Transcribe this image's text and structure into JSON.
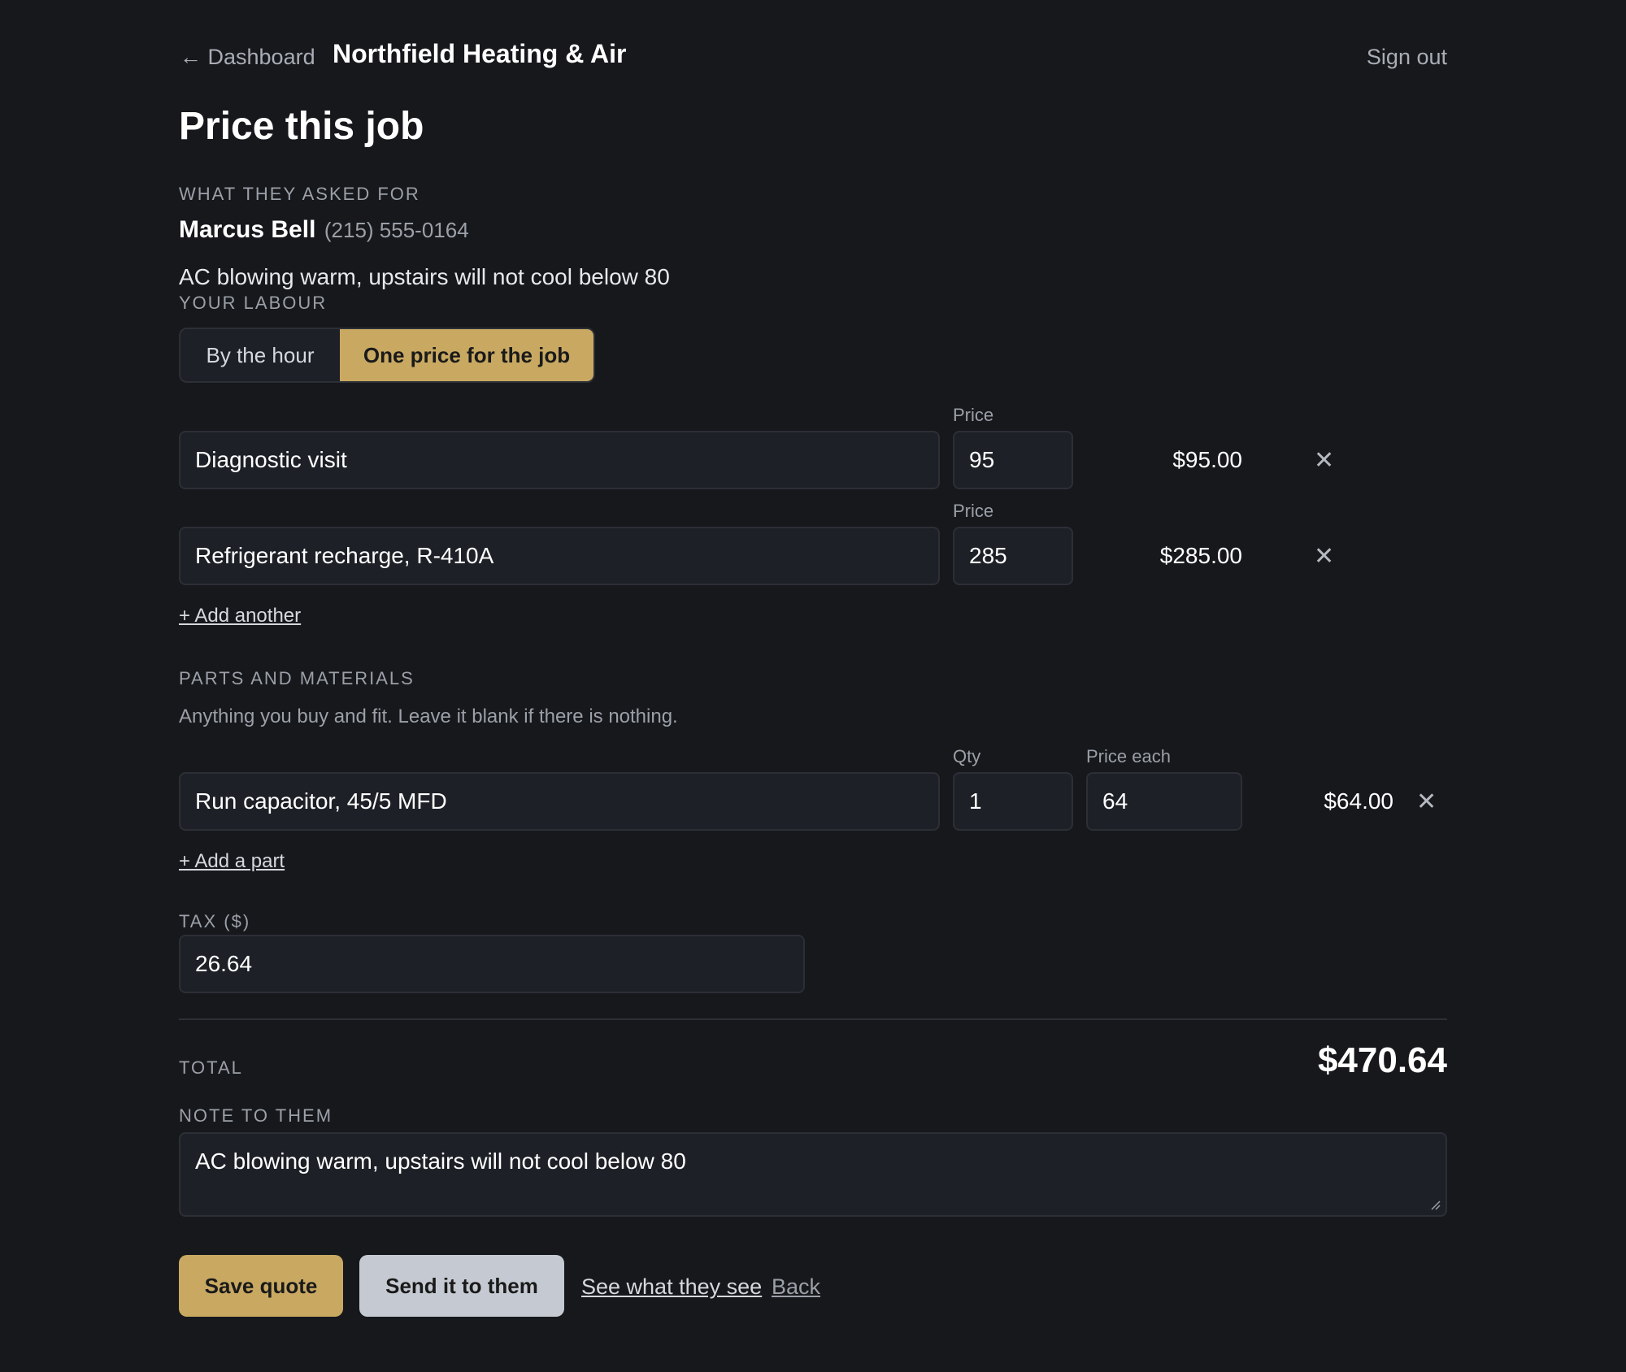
{
  "header": {
    "back_label": "← Dashboard",
    "business_name": "Northfield Heating & Air",
    "signout_label": "Sign out"
  },
  "page_title": "Price this job",
  "request": {
    "section_label": "What they asked for",
    "customer_name": "Marcus Bell",
    "customer_phone": "(215) 555-0164",
    "description": "AC blowing warm, upstairs will not cool below 80"
  },
  "labour": {
    "section_label": "Your labour",
    "modes": [
      "By the hour",
      "One price for the job"
    ],
    "selected_mode": "One price for the job",
    "price_label": "Price",
    "items": [
      {
        "description": "Diagnostic visit",
        "price": "95",
        "amount": "$95.00"
      },
      {
        "description": "Refrigerant recharge, R-410A",
        "price": "285",
        "amount": "$285.00"
      }
    ],
    "add_label": "+ Add another",
    "remove_icon": "close-icon"
  },
  "parts": {
    "section_label": "Parts and materials",
    "hint": "Anything you buy and fit. Leave it blank if there is nothing.",
    "qty_label": "Qty",
    "price_each_label": "Price each",
    "items": [
      {
        "description": "Run capacitor, 45/5 MFD",
        "qty": "1",
        "price_each": "64",
        "amount": "$64.00"
      }
    ],
    "add_label": "+ Add a part"
  },
  "tax": {
    "label": "Tax ($)",
    "value": "26.64"
  },
  "total": {
    "label": "Total",
    "value": "$470.64"
  },
  "note": {
    "label": "Note to them",
    "value": "AC blowing warm, upstairs will not cool below 80"
  },
  "actions": {
    "save_label": "Save quote",
    "send_label": "Send it to them",
    "preview_label": "See what they see",
    "back_label": "Back"
  },
  "colors": {
    "accent": "#c9a962",
    "background": "#16181c",
    "field_background": "#1d2026",
    "secondary_button": "#c5cad2"
  }
}
